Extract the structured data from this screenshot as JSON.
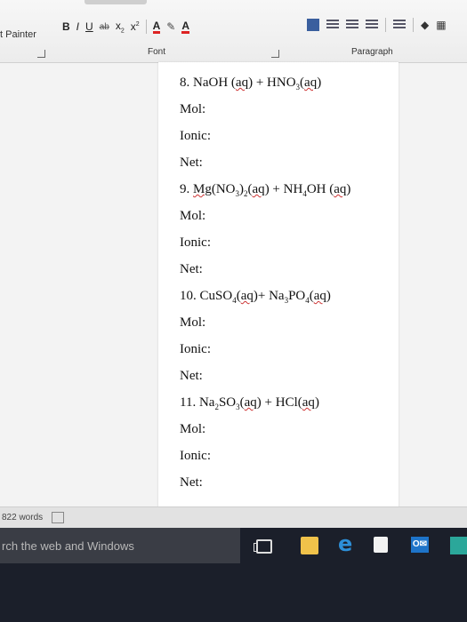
{
  "ribbon": {
    "clipboard_label": "t Painter",
    "format_buttons": [
      "B",
      "I",
      "U",
      "ab",
      "x",
      "x"
    ],
    "font_color_glyph": "A",
    "highlight_glyph": "A",
    "font_group_label": "Font",
    "paragraph_group_label": "Paragraph"
  },
  "document": {
    "lines": [
      "8. NaOH (aq) + HNO₃(aq)",
      "Mol:",
      "Ionic:",
      "Net:",
      "9. Mg(NO₃)₂(aq) + NH₄OH (aq)",
      "Mol:",
      "Ionic:",
      "Net:",
      "10. CuSO₄(aq)+ Na₃PO₄(aq)",
      "Mol:",
      "Ionic:",
      "Net:",
      "11. Na₂SO₃(aq) + HCl(aq)",
      "Mol:",
      "Ionic:",
      "Net:"
    ]
  },
  "statusbar": {
    "word_count": "822 words"
  },
  "taskbar": {
    "search_placeholder": "rch the web and Windows",
    "outlook_label": "O✉"
  },
  "colors": {
    "taskbar_bg": "#1b1f2a",
    "search_bg": "#3a3d45",
    "edge_blue": "#2d8fd8",
    "explorer_yellow": "#f0c24a"
  }
}
